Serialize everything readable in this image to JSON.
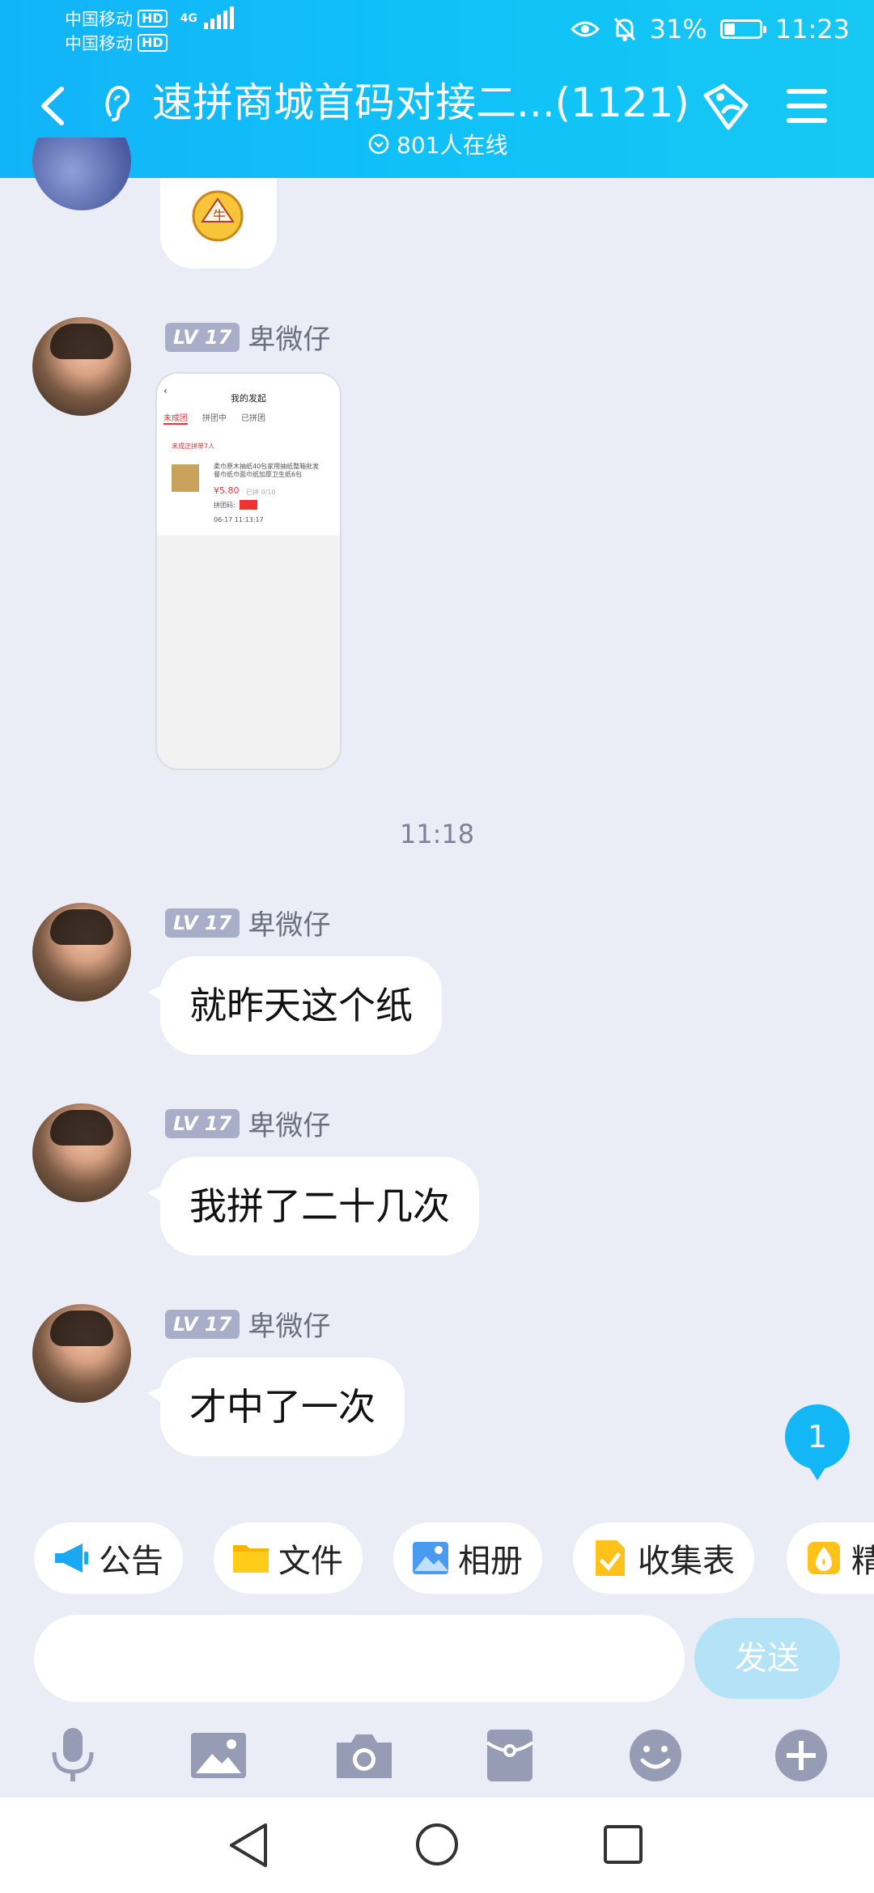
{
  "status_bar": {
    "carrier_1": "中国移动",
    "carrier_2": "中国移动",
    "hd_label": "HD",
    "network": "4G",
    "battery": "31%",
    "battery_level": 0.31,
    "time": "11:23"
  },
  "header": {
    "title": "速拼商城首码对接二...(1121)",
    "online": "801人在线"
  },
  "messages": [
    {
      "level": "LV 17",
      "nick": "卑微仔",
      "type": "image"
    },
    {
      "level": "LV 17",
      "nick": "卑微仔",
      "text": "就昨天这个纸"
    },
    {
      "level": "LV 17",
      "nick": "卑微仔",
      "text": "我拼了二十几次"
    },
    {
      "level": "LV 17",
      "nick": "卑微仔",
      "text": "才中了一次"
    }
  ],
  "timestamp": "11:18",
  "shared_image": {
    "title": "我的发起",
    "tabs": [
      "未成团",
      "拼团中",
      "已拼团"
    ],
    "notice": "未成正拼单7人",
    "product_line_1": "柔巾原木抽纸40包家用抽纸整箱批发",
    "product_line_2": "餐巾纸巾面巾纸加厚卫生纸6包",
    "price": "¥5.80",
    "original_price": "已拼 0/10",
    "status_label": "拼团码:",
    "date": "06-17 11:13:17"
  },
  "unread_count": "1",
  "quick_actions": [
    {
      "label": "公告",
      "icon": "megaphone-icon"
    },
    {
      "label": "文件",
      "icon": "folder-icon"
    },
    {
      "label": "相册",
      "icon": "album-icon"
    },
    {
      "label": "收集表",
      "icon": "form-icon"
    },
    {
      "label": "精",
      "icon": "essence-icon"
    }
  ],
  "input": {
    "placeholder": ""
  },
  "send_label": "发送",
  "toolbar": [
    "microphone-icon",
    "image-icon",
    "camera-icon",
    "red-packet-icon",
    "emoji-icon",
    "plus-icon"
  ],
  "colors": {
    "header": "#12b4f8",
    "background": "#eaedf5",
    "send_disabled": "#b4e2f7",
    "badge": "#a9aec8"
  }
}
